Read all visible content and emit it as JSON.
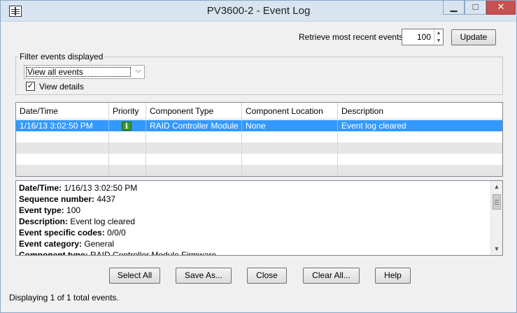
{
  "window": {
    "title": "PV3600-2 - Event Log",
    "controls": {
      "minimize": "▁",
      "maximize": "□",
      "close": "✕"
    }
  },
  "retrieve": {
    "label": "Retrieve most recent events:",
    "value": "100",
    "update_label": "Update"
  },
  "filter": {
    "group_label": "Filter events displayed",
    "selected": "View all events",
    "view_details_label": "View details",
    "view_details_checked": true
  },
  "table": {
    "columns": [
      "Date/Time",
      "Priority",
      "Component Type",
      "Component Location",
      "Description"
    ],
    "rows": [
      {
        "datetime": "1/16/13 3:02:50 PM",
        "priority_icon": "info-icon",
        "priority_glyph": "i",
        "component_type": "RAID Controller Module ...",
        "component_location": "None",
        "description": "Event log cleared"
      }
    ]
  },
  "details": [
    {
      "label": "Date/Time:",
      "value": "1/16/13 3:02:50 PM"
    },
    {
      "label": "Sequence number:",
      "value": "4437"
    },
    {
      "label": "Event type:",
      "value": "100"
    },
    {
      "label": "Description:",
      "value": "Event log cleared"
    },
    {
      "label": "Event specific codes:",
      "value": "0/0/0"
    },
    {
      "label": "Event category:",
      "value": "General"
    },
    {
      "label": "Component type:",
      "value": "RAID Controller Module Firmware"
    }
  ],
  "buttons": {
    "select_all": "Select All",
    "save_as": "Save As...",
    "close": "Close",
    "clear_all": "Clear All...",
    "help": "Help"
  },
  "status": "Displaying 1 of 1 total events."
}
